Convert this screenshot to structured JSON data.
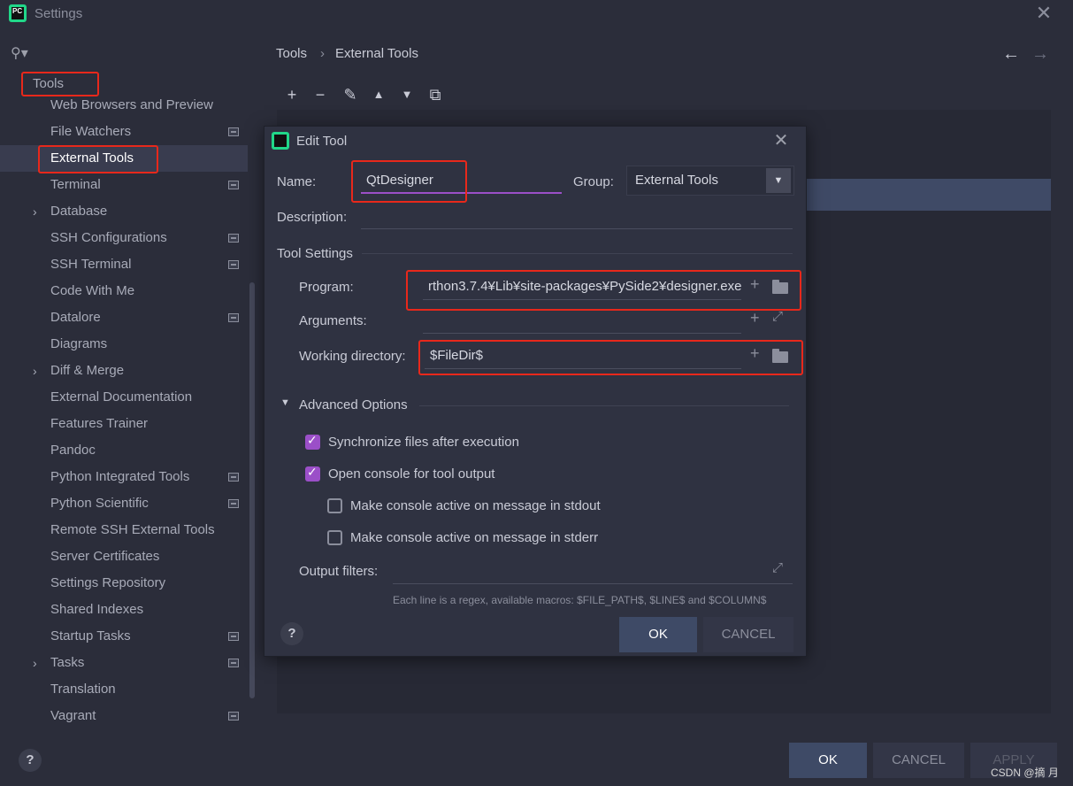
{
  "window": {
    "title": "Settings",
    "close_glyph": "✕"
  },
  "sidebar": {
    "search_icon": "search-icon",
    "tools_label": "Tools",
    "items": [
      {
        "label": "Web Browsers and Preview",
        "chevron": false,
        "badge": false,
        "selected": false
      },
      {
        "label": "File Watchers",
        "chevron": false,
        "badge": true,
        "selected": false
      },
      {
        "label": "External Tools",
        "chevron": false,
        "badge": false,
        "selected": true
      },
      {
        "label": "Terminal",
        "chevron": false,
        "badge": true,
        "selected": false
      },
      {
        "label": "Database",
        "chevron": true,
        "badge": false,
        "selected": false
      },
      {
        "label": "SSH Configurations",
        "chevron": false,
        "badge": true,
        "selected": false
      },
      {
        "label": "SSH Terminal",
        "chevron": false,
        "badge": true,
        "selected": false
      },
      {
        "label": "Code With Me",
        "chevron": false,
        "badge": false,
        "selected": false
      },
      {
        "label": "Datalore",
        "chevron": false,
        "badge": true,
        "selected": false
      },
      {
        "label": "Diagrams",
        "chevron": false,
        "badge": false,
        "selected": false
      },
      {
        "label": "Diff & Merge",
        "chevron": true,
        "badge": false,
        "selected": false
      },
      {
        "label": "External Documentation",
        "chevron": false,
        "badge": false,
        "selected": false
      },
      {
        "label": "Features Trainer",
        "chevron": false,
        "badge": false,
        "selected": false
      },
      {
        "label": "Pandoc",
        "chevron": false,
        "badge": false,
        "selected": false
      },
      {
        "label": "Python Integrated Tools",
        "chevron": false,
        "badge": true,
        "selected": false
      },
      {
        "label": "Python Scientific",
        "chevron": false,
        "badge": true,
        "selected": false
      },
      {
        "label": "Remote SSH External Tools",
        "chevron": false,
        "badge": false,
        "selected": false
      },
      {
        "label": "Server Certificates",
        "chevron": false,
        "badge": false,
        "selected": false
      },
      {
        "label": "Settings Repository",
        "chevron": false,
        "badge": false,
        "selected": false
      },
      {
        "label": "Shared Indexes",
        "chevron": false,
        "badge": false,
        "selected": false
      },
      {
        "label": "Startup Tasks",
        "chevron": false,
        "badge": true,
        "selected": false
      },
      {
        "label": "Tasks",
        "chevron": true,
        "badge": true,
        "selected": false
      },
      {
        "label": "Translation",
        "chevron": false,
        "badge": false,
        "selected": false
      },
      {
        "label": "Vagrant",
        "chevron": false,
        "badge": true,
        "selected": false
      }
    ]
  },
  "breadcrumb": {
    "parent": "Tools",
    "separator": "›",
    "current": "External Tools",
    "back": "←",
    "forward": "→"
  },
  "toolbar": {
    "add": "+",
    "remove": "−",
    "edit": "✎",
    "up": "▲",
    "down": "▼",
    "copy": "⧉"
  },
  "dialog": {
    "title": "Edit Tool",
    "name_label": "Name:",
    "name_value": "QtDesigner",
    "group_label": "Group:",
    "group_value": "External Tools",
    "description_label": "Description:",
    "description_value": "",
    "tool_settings_label": "Tool Settings",
    "program_label": "Program:",
    "program_value": "rthon3.7.4¥Lib¥site-packages¥PySide2¥designer.exe",
    "arguments_label": "Arguments:",
    "arguments_value": "",
    "workdir_label": "Working directory:",
    "workdir_value": "$FileDir$",
    "advanced_label": "Advanced Options",
    "sync_label": "Synchronize files after execution",
    "sync_checked": true,
    "console_label": "Open console for tool output",
    "console_checked": true,
    "stdout_label": "Make console active on message in stdout",
    "stdout_checked": false,
    "stderr_label": "Make console active on message in stderr",
    "stderr_checked": false,
    "output_filters_label": "Output filters:",
    "output_filters_value": "",
    "hint": "Each line is a regex, available macros: $FILE_PATH$, $LINE$ and $COLUMN$",
    "ok_label": "OK",
    "cancel_label": "CANCEL",
    "help_label": "?"
  },
  "footer": {
    "ok_label": "OK",
    "cancel_label": "CANCEL",
    "apply_label": "APPLY",
    "help_label": "?"
  },
  "watermark": "CSDN @摘 月",
  "colors": {
    "background": "#2b2d3a",
    "accent": "#9b4fc8",
    "selection": "#3f4a66",
    "highlight_box": "#e8281b"
  }
}
